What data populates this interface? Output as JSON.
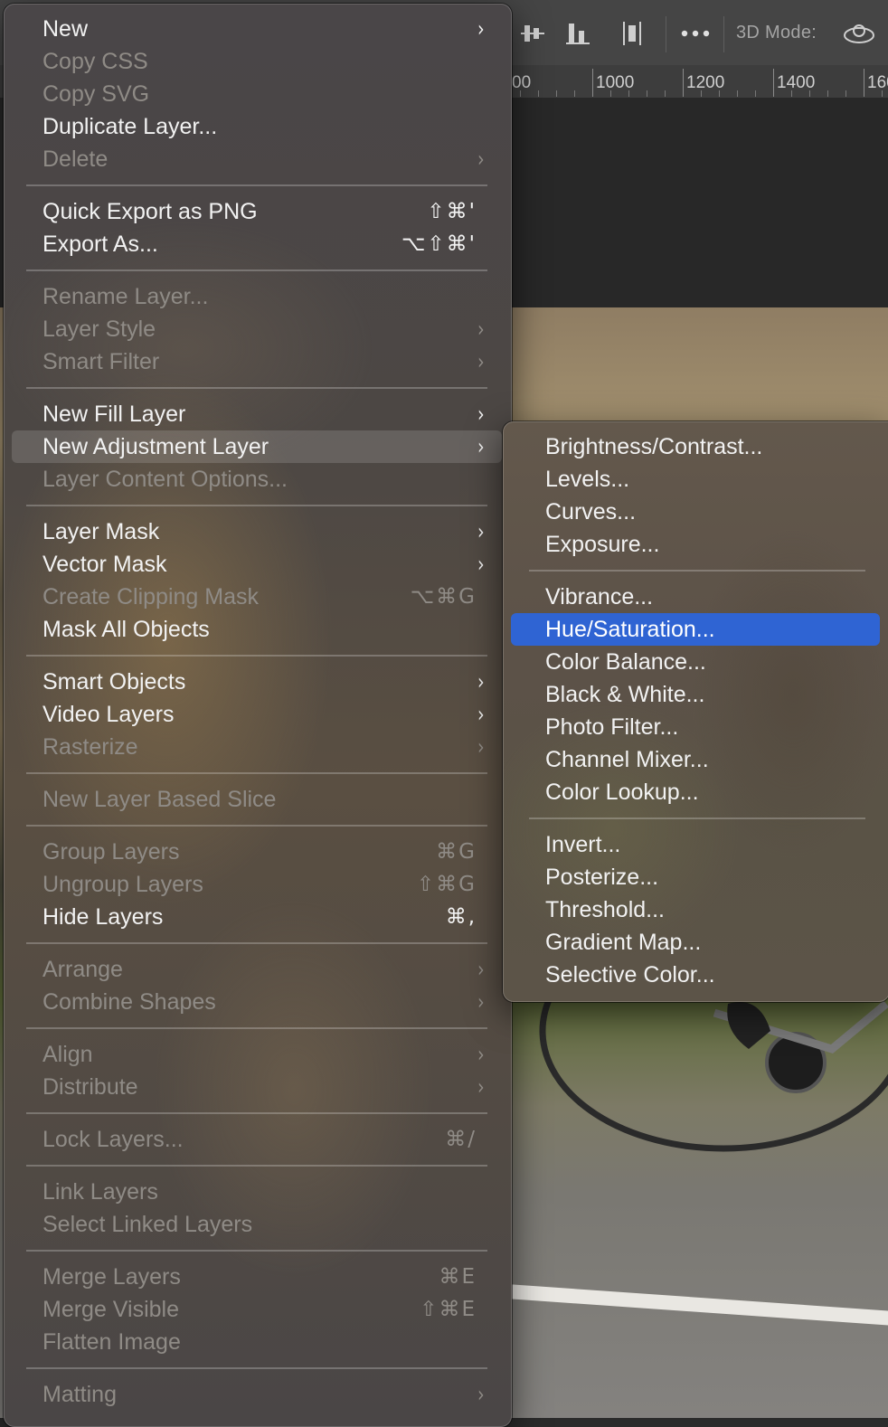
{
  "toolbar": {
    "mode_label": "3D Mode:",
    "icons": [
      "align-vertical-centers-icon",
      "align-bottom-edges-icon",
      "distribute-horizontal-icon",
      "more-options-icon",
      "3d-orbit-icon"
    ]
  },
  "ruler": {
    "labels": [
      "00",
      "1000",
      "1200",
      "1400",
      "160"
    ]
  },
  "colors": {
    "highlight": "#2f64d3",
    "enabled_text": "#f2f2f2",
    "disabled_text": "#8f8b86"
  },
  "main_menu": {
    "groups": [
      [
        {
          "label": "New",
          "enabled": true,
          "submenu": true
        },
        {
          "label": "Copy CSS",
          "enabled": false
        },
        {
          "label": "Copy SVG",
          "enabled": false
        },
        {
          "label": "Duplicate Layer...",
          "enabled": true
        },
        {
          "label": "Delete",
          "enabled": false,
          "submenu": true
        }
      ],
      [
        {
          "label": "Quick Export as PNG",
          "enabled": true,
          "shortcut": "⇧⌘'"
        },
        {
          "label": "Export As...",
          "enabled": true,
          "shortcut": "⌥⇧⌘'"
        }
      ],
      [
        {
          "label": "Rename Layer...",
          "enabled": false
        },
        {
          "label": "Layer Style",
          "enabled": false,
          "submenu": true
        },
        {
          "label": "Smart Filter",
          "enabled": false,
          "submenu": true
        }
      ],
      [
        {
          "label": "New Fill Layer",
          "enabled": true,
          "submenu": true
        },
        {
          "label": "New Adjustment Layer",
          "enabled": true,
          "submenu": true,
          "hover": true
        },
        {
          "label": "Layer Content Options...",
          "enabled": false
        }
      ],
      [
        {
          "label": "Layer Mask",
          "enabled": true,
          "submenu": true
        },
        {
          "label": "Vector Mask",
          "enabled": true,
          "submenu": true
        },
        {
          "label": "Create Clipping Mask",
          "enabled": false,
          "shortcut": "⌥⌘G"
        },
        {
          "label": "Mask All Objects",
          "enabled": true
        }
      ],
      [
        {
          "label": "Smart Objects",
          "enabled": true,
          "submenu": true
        },
        {
          "label": "Video Layers",
          "enabled": true,
          "submenu": true
        },
        {
          "label": "Rasterize",
          "enabled": false,
          "submenu": true
        }
      ],
      [
        {
          "label": "New Layer Based Slice",
          "enabled": false
        }
      ],
      [
        {
          "label": "Group Layers",
          "enabled": false,
          "shortcut": "⌘G"
        },
        {
          "label": "Ungroup Layers",
          "enabled": false,
          "shortcut": "⇧⌘G"
        },
        {
          "label": "Hide Layers",
          "enabled": true,
          "shortcut": "⌘,"
        }
      ],
      [
        {
          "label": "Arrange",
          "enabled": false,
          "submenu": true
        },
        {
          "label": "Combine Shapes",
          "enabled": false,
          "submenu": true
        }
      ],
      [
        {
          "label": "Align",
          "enabled": false,
          "submenu": true
        },
        {
          "label": "Distribute",
          "enabled": false,
          "submenu": true
        }
      ],
      [
        {
          "label": "Lock Layers...",
          "enabled": false,
          "shortcut": "⌘/"
        }
      ],
      [
        {
          "label": "Link Layers",
          "enabled": false
        },
        {
          "label": "Select Linked Layers",
          "enabled": false
        }
      ],
      [
        {
          "label": "Merge Layers",
          "enabled": false,
          "shortcut": "⌘E"
        },
        {
          "label": "Merge Visible",
          "enabled": false,
          "shortcut": "⇧⌘E"
        },
        {
          "label": "Flatten Image",
          "enabled": false
        }
      ],
      [
        {
          "label": "Matting",
          "enabled": false,
          "submenu": true
        }
      ]
    ]
  },
  "adjustment_submenu": {
    "groups": [
      [
        {
          "label": "Brightness/Contrast...",
          "enabled": true
        },
        {
          "label": "Levels...",
          "enabled": true
        },
        {
          "label": "Curves...",
          "enabled": true
        },
        {
          "label": "Exposure...",
          "enabled": true
        }
      ],
      [
        {
          "label": "Vibrance...",
          "enabled": true
        },
        {
          "label": "Hue/Saturation...",
          "enabled": true,
          "selected": true
        },
        {
          "label": "Color Balance...",
          "enabled": true
        },
        {
          "label": "Black & White...",
          "enabled": true
        },
        {
          "label": "Photo Filter...",
          "enabled": true
        },
        {
          "label": "Channel Mixer...",
          "enabled": true
        },
        {
          "label": "Color Lookup...",
          "enabled": true
        }
      ],
      [
        {
          "label": "Invert...",
          "enabled": true
        },
        {
          "label": "Posterize...",
          "enabled": true
        },
        {
          "label": "Threshold...",
          "enabled": true
        },
        {
          "label": "Gradient Map...",
          "enabled": true
        },
        {
          "label": "Selective Color...",
          "enabled": true
        }
      ]
    ]
  }
}
